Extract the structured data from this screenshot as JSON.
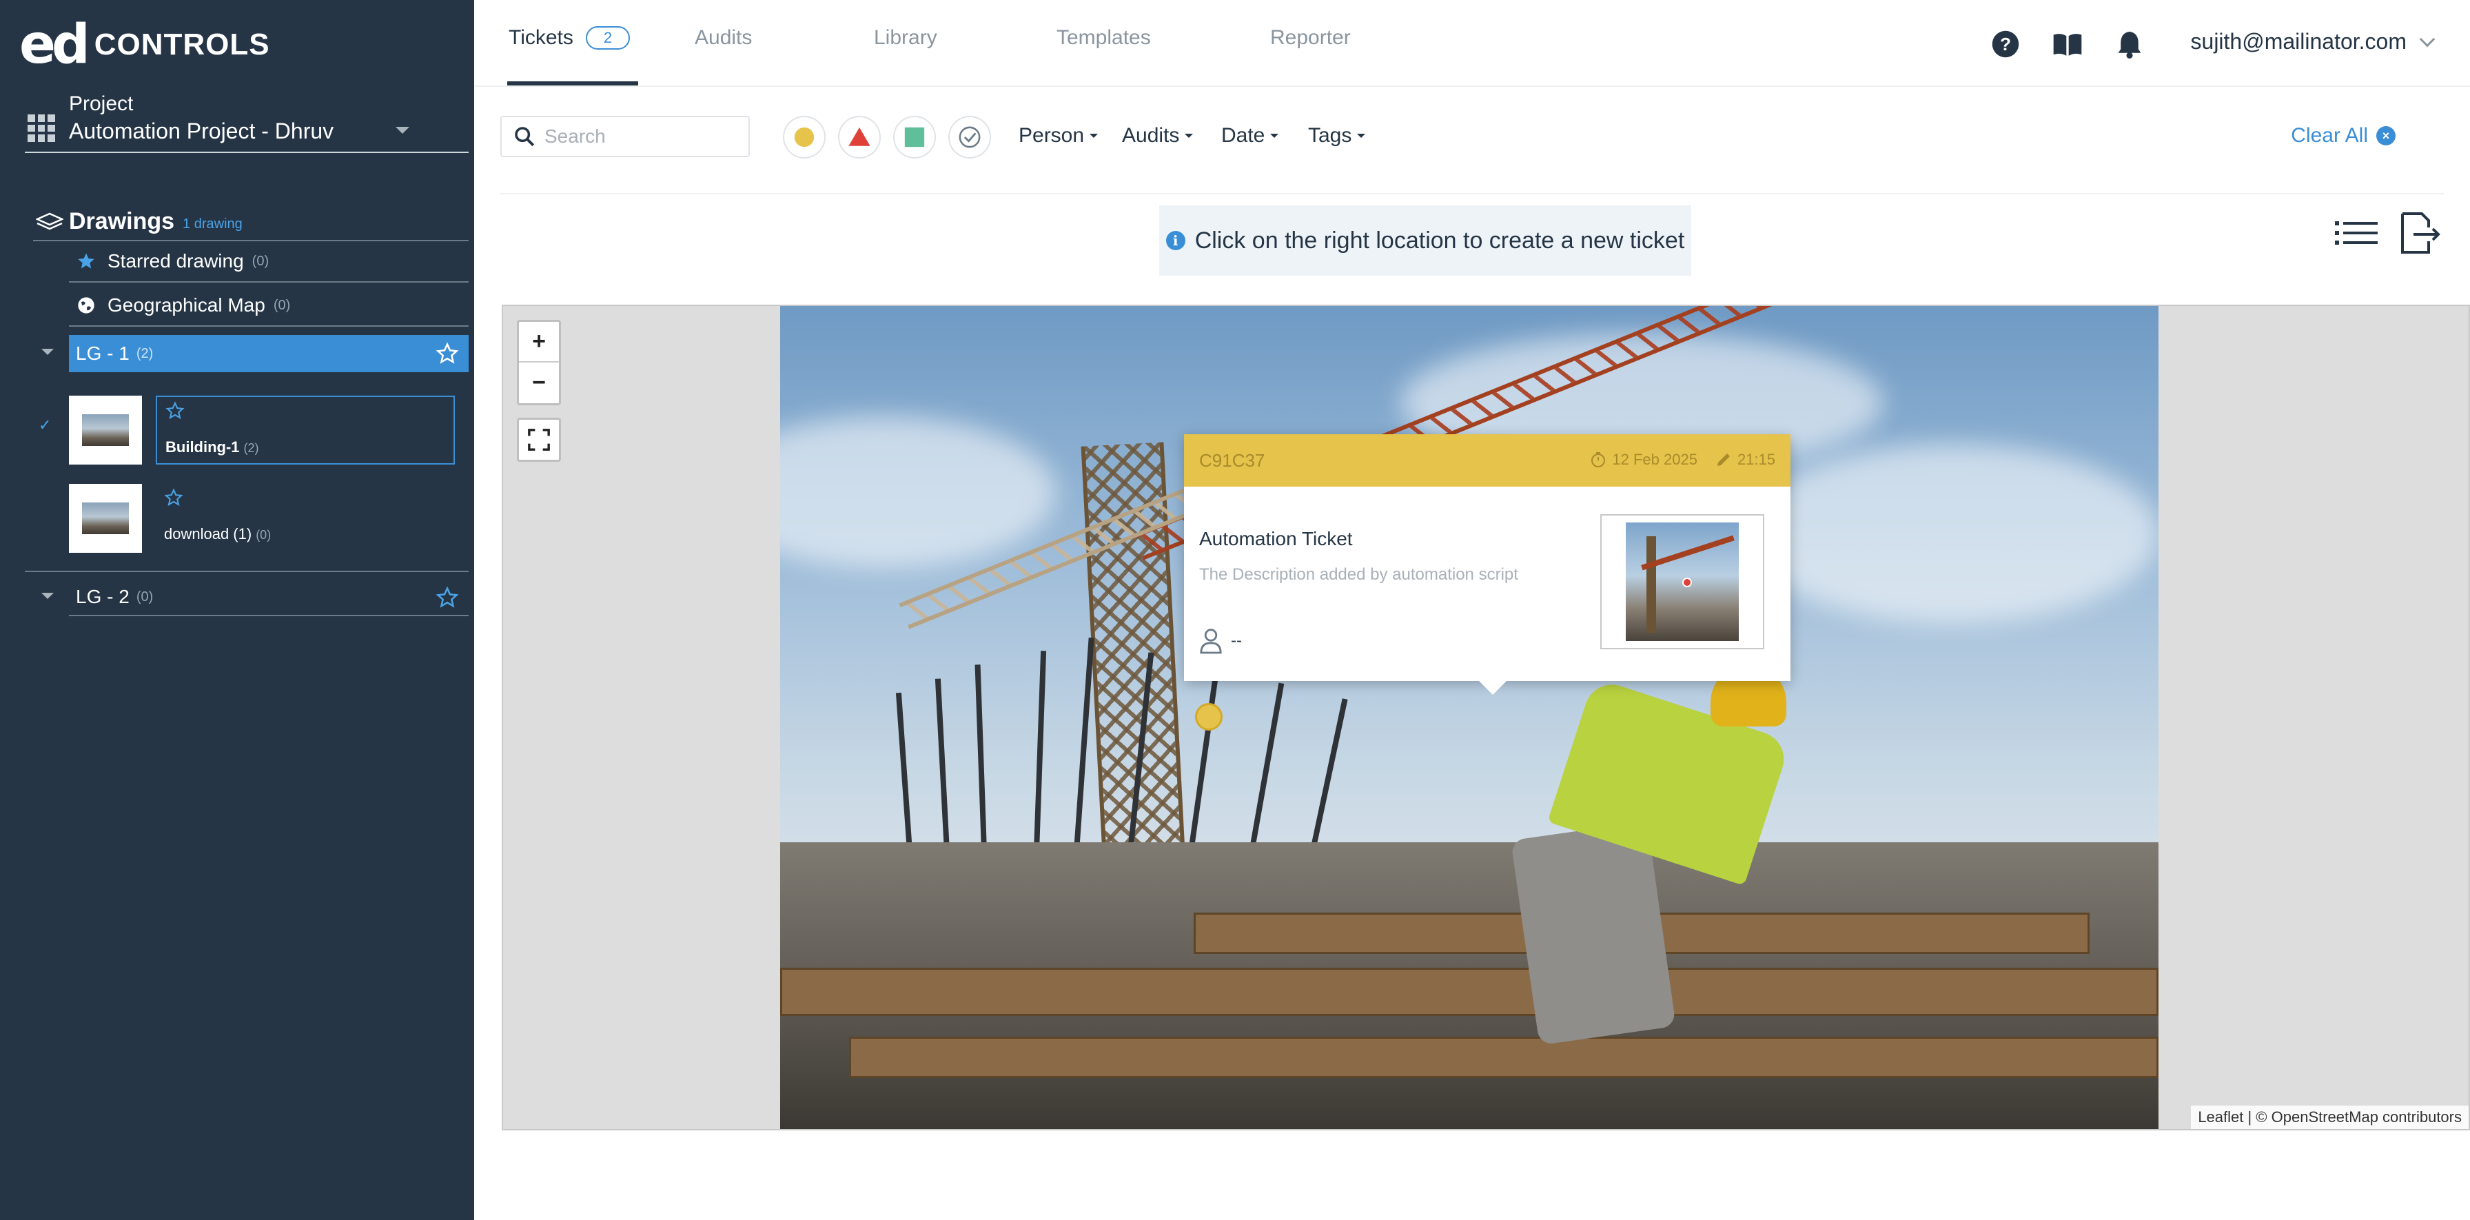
{
  "sidebar": {
    "logo_mark": "ed",
    "logo_text": "CONTROLS",
    "project_label": "Project",
    "project_name": "Automation Project - Dhruv",
    "drawings_title": "Drawings",
    "drawings_count": "1 drawing",
    "starred": {
      "label": "Starred drawing",
      "count": "(0)"
    },
    "geo": {
      "label": "Geographical Map",
      "count": "(0)"
    },
    "groups": [
      {
        "label": "LG - 1",
        "count": "(2)"
      },
      {
        "label": "LG - 2",
        "count": "(0)"
      }
    ],
    "drawings": [
      {
        "name": "Building-1",
        "count": "(2)"
      },
      {
        "name": "download (1)",
        "count": "(0)"
      }
    ],
    "checkmark": "✓"
  },
  "nav": {
    "tabs": [
      {
        "label": "Tickets",
        "badge": "2"
      },
      {
        "label": "Audits"
      },
      {
        "label": "Library"
      },
      {
        "label": "Templates"
      },
      {
        "label": "Reporter"
      }
    ],
    "user_email": "sujith@mailinator.com",
    "icons": [
      "help-icon",
      "book-icon",
      "bell-icon"
    ]
  },
  "filters": {
    "search_placeholder": "Search",
    "dropdowns": [
      "Person",
      "Audits",
      "Date",
      "Tags"
    ],
    "clear_all": "Clear All",
    "shape_colors": {
      "circle": "#e6c34a",
      "triangle": "#e0403a",
      "square": "#5fbf9a"
    }
  },
  "info_message": "Click on the right location to create a new ticket",
  "map": {
    "zoom_in": "+",
    "zoom_out": "−",
    "attribution": "Leaflet | © OpenStreetMap contributors"
  },
  "popup": {
    "id": "C91C37",
    "date": "12 Feb 2025",
    "time": "21:15",
    "title": "Automation Ticket",
    "description": "The Description added by automation script",
    "assignee": "--",
    "header_color": "#e6c34a"
  }
}
